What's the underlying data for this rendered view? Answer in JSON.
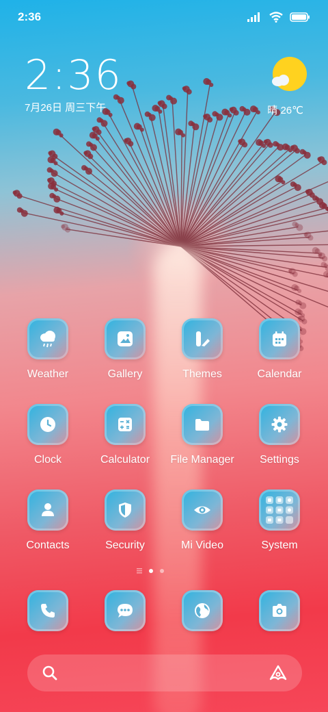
{
  "status_bar": {
    "time": "2:36"
  },
  "clock_widget": {
    "time": "2:36",
    "date": "7月26日 周三下午"
  },
  "weather_widget": {
    "text": "晴 26℃"
  },
  "apps": [
    {
      "label": "Weather",
      "icon": "cloud-rain-icon"
    },
    {
      "label": "Gallery",
      "icon": "image-icon"
    },
    {
      "label": "Themes",
      "icon": "themes-icon"
    },
    {
      "label": "Calendar",
      "icon": "calendar-icon"
    },
    {
      "label": "Clock",
      "icon": "clock-icon"
    },
    {
      "label": "Calculator",
      "icon": "calculator-icon"
    },
    {
      "label": "File Manager",
      "icon": "folder-icon"
    },
    {
      "label": "Settings",
      "icon": "gear-icon"
    },
    {
      "label": "Contacts",
      "icon": "person-icon"
    },
    {
      "label": "Security",
      "icon": "shield-icon"
    },
    {
      "label": "Mi Video",
      "icon": "eye-icon"
    },
    {
      "label": "System",
      "icon": "folder-grid-icon"
    }
  ],
  "pager": {
    "pages": 2,
    "current": 1
  },
  "dock": [
    {
      "icon": "phone-icon"
    },
    {
      "icon": "message-icon"
    },
    {
      "icon": "browser-globe-icon"
    },
    {
      "icon": "camera-icon"
    }
  ],
  "colors": {
    "tile_start": "#2eb3e0",
    "tile_end": "#d68f9d",
    "sky": "#1fb2e8",
    "red": "#f23a4a"
  }
}
